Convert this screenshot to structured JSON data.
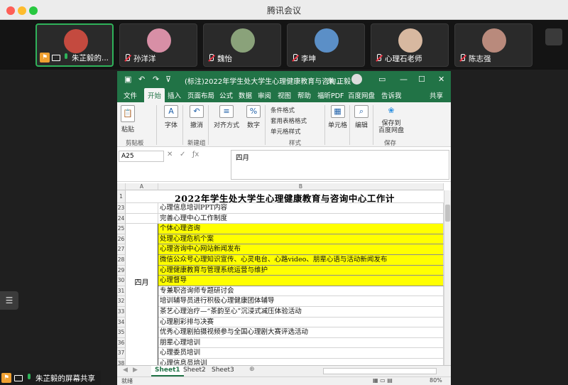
{
  "app": {
    "title": "腾讯会议"
  },
  "participants": [
    {
      "name": "朱芷毅的...",
      "color": "#c44a3f",
      "host": true,
      "mic": "on"
    },
    {
      "name": "孙洋洋",
      "color": "#d88fa6",
      "host": false,
      "mic": "off"
    },
    {
      "name": "魏怡",
      "color": "#8aa27a",
      "host": false,
      "mic": "off"
    },
    {
      "name": "李坤",
      "color": "#5b8fc7",
      "host": false,
      "mic": "off"
    },
    {
      "name": "心理石老师",
      "color": "#d7b8a0",
      "host": false,
      "mic": "off"
    },
    {
      "name": "陈志强",
      "color": "#b98a7c",
      "host": false,
      "mic": "off"
    }
  ],
  "excel": {
    "doc_title": "(标注)2022年学生处大学生心理健康教育与咨询...",
    "user": "朱 正毅",
    "tabs": [
      "文件",
      "开始",
      "插入",
      "页面布局",
      "公式",
      "数据",
      "审阅",
      "视图",
      "帮助",
      "福昕PDF",
      "百度网盘",
      "告诉我",
      "共享"
    ],
    "ribbon": {
      "paste": "粘贴",
      "font": "字体",
      "undo": "撤消",
      "align": "对齐方式",
      "number": "数字",
      "cond_format": "条件格式",
      "table_format": "套用表格格式",
      "cell_style": "单元格样式",
      "cells": "单元格",
      "edit": "编辑",
      "save_baidu": "保存到\n百度网盘",
      "grp_clipboard": "剪贴板",
      "grp_new": "新建组",
      "grp_style": "样式",
      "grp_save": "保存"
    },
    "namebox": "A25",
    "formula": "四月",
    "col_a": "A",
    "col_b": "B",
    "sheet_title": "2022年学生处大学生心理健康教育与咨询中心工作计",
    "month_label": "四月",
    "rows": [
      {
        "n": "1",
        "text": ""
      },
      {
        "n": "23",
        "text": "心理信息培训PPT内容",
        "hl": false
      },
      {
        "n": "24",
        "text": "完善心理中心工作制度",
        "hl": false
      },
      {
        "n": "25",
        "text": "个体心理咨询",
        "hl": true
      },
      {
        "n": "26",
        "text": "处理心理危机个案",
        "hl": true
      },
      {
        "n": "27",
        "text": "心理咨询中心网站新闻发布",
        "hl": true
      },
      {
        "n": "28",
        "text": "微信公众号心理知识宣传、心灵电台、心路video、朋辈心语与活动新闻发布",
        "hl": true
      },
      {
        "n": "29",
        "text": "心理健康教育与管理系统运营与维护",
        "hl": true
      },
      {
        "n": "30",
        "text": "心理督导",
        "hl": true
      },
      {
        "n": "31",
        "text": "专兼职咨询师专题研讨会",
        "hl": false
      },
      {
        "n": "32",
        "text": "培训辅导员进行积极心理健康团体辅导",
        "hl": false
      },
      {
        "n": "33",
        "text": "茶艺心理治疗—“茶韵至心”沉浸式减压体验活动",
        "hl": false
      },
      {
        "n": "34",
        "text": "心理剧彩排与决赛",
        "hl": false
      },
      {
        "n": "35",
        "text": "优秀心理剧拍摄视频参与全国心理剧大赛评选活动",
        "hl": false
      },
      {
        "n": "36",
        "text": "朋辈心理培训",
        "hl": false
      },
      {
        "n": "37",
        "text": "心理委员培训",
        "hl": false
      },
      {
        "n": "38",
        "text": "心理信息员培训",
        "hl": false
      }
    ],
    "sheets": [
      "Sheet1",
      "Sheet2",
      "Sheet3"
    ],
    "status_left": "就绪",
    "zoom": "80%"
  },
  "share_label": "朱芷毅的屏幕共享",
  "accent": "#217346",
  "highlight": "#ffff00"
}
